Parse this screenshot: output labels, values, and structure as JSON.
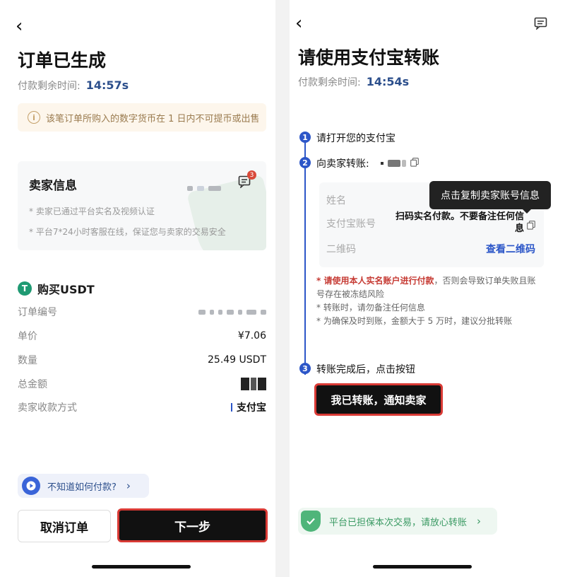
{
  "left": {
    "title": "订单已生成",
    "timer_label": "付款剩余时间:",
    "timer_value": "14:57s",
    "warning": "该笔订单所购入的数字货币在 1 日内不可提币或出售",
    "seller_card": {
      "title": "卖家信息",
      "badge": "3",
      "notes": [
        "* 卖家已通过平台实名及视频认证",
        "* 平台7*24小时客服在线，保证您与卖家的交易安全"
      ]
    },
    "buy": {
      "coin_icon": "T",
      "title": "购买USDT",
      "rows": [
        {
          "label": "订单编号",
          "value": ""
        },
        {
          "label": "单价",
          "value": "¥7.06"
        },
        {
          "label": "数量",
          "value": "25.49 USDT"
        },
        {
          "label": "总金额",
          "value": ""
        },
        {
          "label": "卖家收款方式",
          "value": "支付宝"
        }
      ]
    },
    "help": "不知道如何付款?",
    "cancel": "取消订单",
    "next": "下一步"
  },
  "right": {
    "title": "请使用支付宝转账",
    "timer_label": "付款剩余时间:",
    "timer_value": "14:54s",
    "steps": [
      {
        "num": "1",
        "text": "请打开您的支付宝"
      },
      {
        "num": "2",
        "text": "向卖家转账:"
      },
      {
        "num": "3",
        "text": "转账完成后，点击按钮"
      }
    ],
    "info": {
      "name_label": "姓名",
      "account_label": "支付宝账号",
      "account_value": "扫码实名付款。不要备注任何信息",
      "qr_label": "二维码",
      "qr_link": "查看二维码"
    },
    "tooltip": "点击复制卖家账号信息",
    "notes": {
      "n1_red": "* 请使用本人实名账户进行付款",
      "n1_rest": "，否则会导致订单失败且账号存在被冻结风险",
      "n2": "* 转账时，请勿备注任何信息",
      "n3": "* 为确保及时到账，金额大于 5 万时，建议分批转账"
    },
    "confirm_button": "我已转账，通知卖家",
    "safe": "平台已担保本次交易，请放心转账"
  },
  "colors": {
    "accent": "#2c56c8",
    "highlight_border": "#d93a35",
    "primary_button": "#111111"
  }
}
